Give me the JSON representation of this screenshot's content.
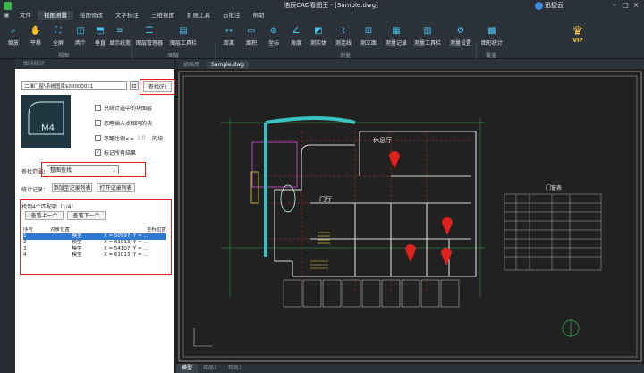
{
  "window": {
    "title": "浩辰CAD看图王 - [Sample.dwg]",
    "brand": "迅捷云"
  },
  "menu": [
    "文件",
    "视图测量",
    "绘图修改",
    "文字标注",
    "三维视图",
    "扩展工具",
    "云批注",
    "帮助"
  ],
  "menu_active": 1,
  "ribbon": {
    "buttons": [
      "缩放",
      "平移",
      "全屏",
      "两个",
      "垂直",
      "显示线宽",
      "图层管理器",
      "图层工具栏",
      "距离",
      "面积",
      "坐标",
      "角度",
      "测实体",
      "测连线",
      "测立面",
      "测量记录",
      "测量工具栏",
      "测量设置",
      "图形统计"
    ],
    "groups": [
      "视图",
      "图层",
      "测量",
      "覆盖"
    ],
    "vip": "VIP"
  },
  "panel": {
    "title": "图块统计",
    "block_name": "二维门窗\\系统图库$00000011",
    "find_button": "查找(F)",
    "preview_label": "M4",
    "options": [
      {
        "label": "只统计选中的块图层",
        "checked": false
      },
      {
        "label": "忽略插入点相同的块",
        "checked": false
      },
      {
        "label": "忽略比例<=",
        "suffix": "的块",
        "value": "1.0",
        "checked": false
      },
      {
        "label": "标记所有结果",
        "checked": true
      }
    ],
    "range_label": "查找范围：",
    "range_value": "整图查找",
    "record_label": "统计记录：",
    "add_record_button": "添加至记录列表",
    "open_record_button": "打开记录列表",
    "found_text": "找到4个匹配项（1/4）",
    "prev_button": "查看上一个",
    "next_button": "查看下一个",
    "result_headers": [
      "序号",
      "对象位置",
      "坐标位置"
    ],
    "results": [
      {
        "no": "1",
        "pos": "模型",
        "coord": "X = 50997, Y = ..."
      },
      {
        "no": "2",
        "pos": "模型",
        "coord": "X = 61013, Y = ..."
      },
      {
        "no": "3",
        "pos": "模型",
        "coord": "X = 54107, Y = ..."
      },
      {
        "no": "4",
        "pos": "模型",
        "coord": "X = 61013, Y = ..."
      }
    ]
  },
  "drawing": {
    "tabs": [
      "初始页",
      "Sample.dwg"
    ],
    "active_tab": 1,
    "labels": {
      "lounge": "休息厅",
      "hall": "门厅",
      "door_table": "门窗表"
    },
    "bottom_tabs": [
      "模型",
      "布局1",
      "布局2"
    ]
  },
  "colors": {
    "accent": "#4cc3f2",
    "red_marker": "#e0201c",
    "vip_gold": "#f5c542",
    "selection": "#2f79d1"
  }
}
